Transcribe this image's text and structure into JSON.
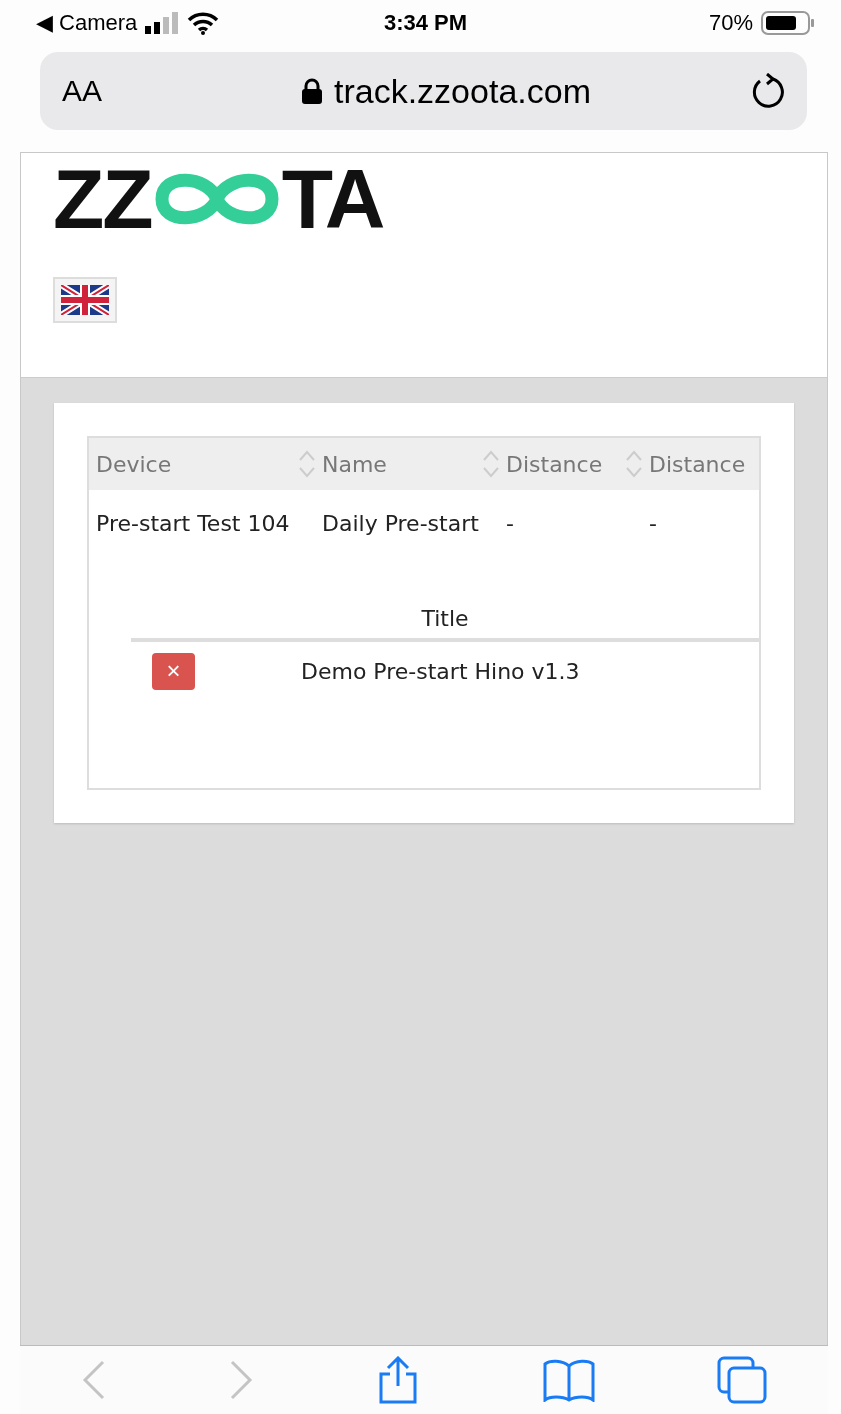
{
  "status_bar": {
    "back_app": "◀ Camera",
    "time": "3:34 PM",
    "battery": "70%"
  },
  "address_bar": {
    "text_size": "AA",
    "url": "track.zzoota.com"
  },
  "header": {
    "logo": {
      "left": "ZZ",
      "right": "TA"
    }
  },
  "table": {
    "columns": [
      {
        "label": "Device",
        "sortable": true
      },
      {
        "label": "Name",
        "sortable": true
      },
      {
        "label": "Distance",
        "sortable": true
      },
      {
        "label": "Distance",
        "sortable": false
      }
    ],
    "rows": [
      {
        "cells": [
          "Pre-start Test 104",
          "Daily Pre-start",
          "-",
          "-"
        ]
      }
    ],
    "subtable": {
      "columns": [
        "Title"
      ],
      "rows": [
        {
          "title": "Demo Pre-start Hino v1.3",
          "remove": "×"
        }
      ]
    }
  },
  "toolbar": [
    {
      "kind": "back",
      "disabled": true
    },
    {
      "kind": "forward",
      "disabled": true
    },
    {
      "kind": "share",
      "disabled": false
    },
    {
      "kind": "bookmarks",
      "disabled": false
    },
    {
      "kind": "tabs",
      "disabled": false
    }
  ]
}
